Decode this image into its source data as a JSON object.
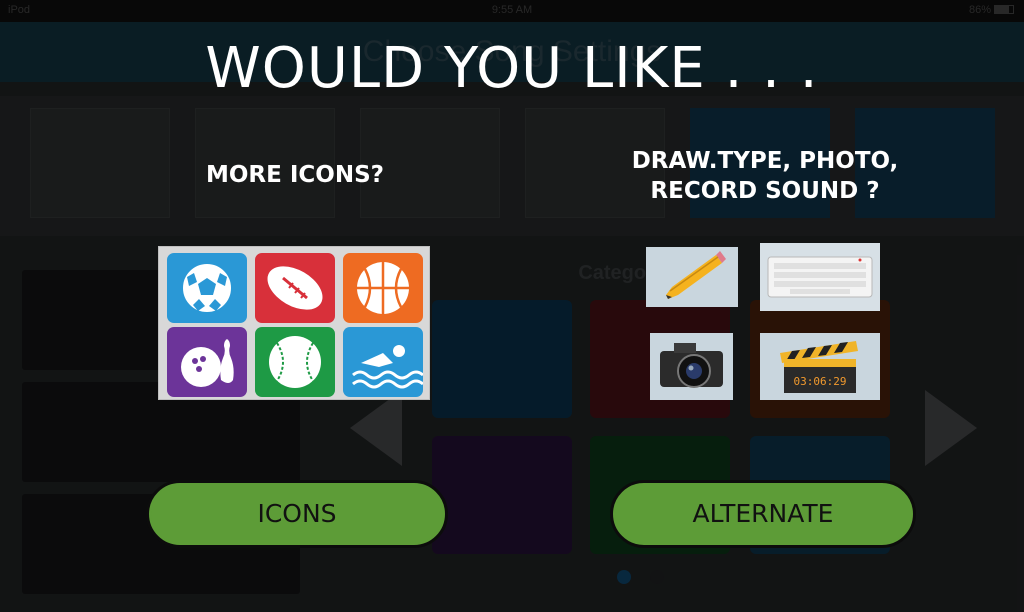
{
  "status_bar": {
    "carrier": "iPod",
    "time": "9:55 AM",
    "battery": "86%"
  },
  "app": {
    "title": "Choose Song Settings",
    "categories_label": "Categories"
  },
  "dialog": {
    "headline": "WOULD YOU LIKE . . .",
    "left_option": {
      "label": "MORE ICONS?",
      "button": "ICONS",
      "icons": [
        "soccer-ball-icon",
        "football-icon",
        "basketball-icon",
        "bowling-icon",
        "baseball-icon",
        "swimming-icon"
      ]
    },
    "right_option": {
      "label_line1": "DRAW.TYPE, PHOTO,",
      "label_line2": "RECORD SOUND ?",
      "button": "ALTERNATE",
      "icons": [
        "pencil-icon",
        "keyboard-icon",
        "camera-icon",
        "clapperboard-icon"
      ],
      "clapper_time": "03:06:29"
    }
  },
  "colors": {
    "button_green": "#5d9c37",
    "tile_blue": "#2a98d6",
    "tile_red": "#d8303a",
    "tile_orange": "#ee6b22",
    "tile_purple": "#6c3499",
    "tile_green": "#1e9a45"
  }
}
